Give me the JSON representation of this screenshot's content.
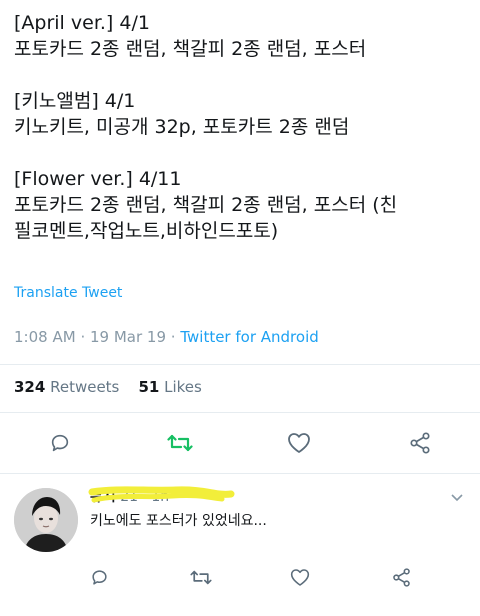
{
  "tweet": {
    "lines": [
      "[April ver.] 4/1",
      "포토카드 2종 랜덤, 책갈피 2종 랜덤, 포스터",
      "",
      "[키노앨범] 4/1",
      "키노키트, 미공개 32p, 포토카트 2종 랜덤",
      "",
      "[Flower ver.] 4/11",
      "포토카드 2종 랜덤, 책갈피 2종 랜덤, 포스터 (친",
      "필코멘트,작업노트,비하인드포토)"
    ],
    "translate_label": "Translate Tweet",
    "time": "1:08 AM",
    "date": "19 Mar 19",
    "source": "Twitter for Android",
    "retweet_count": "324",
    "retweet_label": "Retweets",
    "like_count": "51",
    "like_label": "Likes"
  },
  "reply": {
    "name": "뮤지",
    "time": "21 · 1h",
    "text": "키노에도 포스터가 있었네요..."
  },
  "colors": {
    "accent": "#1da1f2",
    "retweet_green": "#17bf63",
    "muted": "#657786",
    "icon": "#5b6c7a",
    "scribble": "#f2ee3a"
  }
}
